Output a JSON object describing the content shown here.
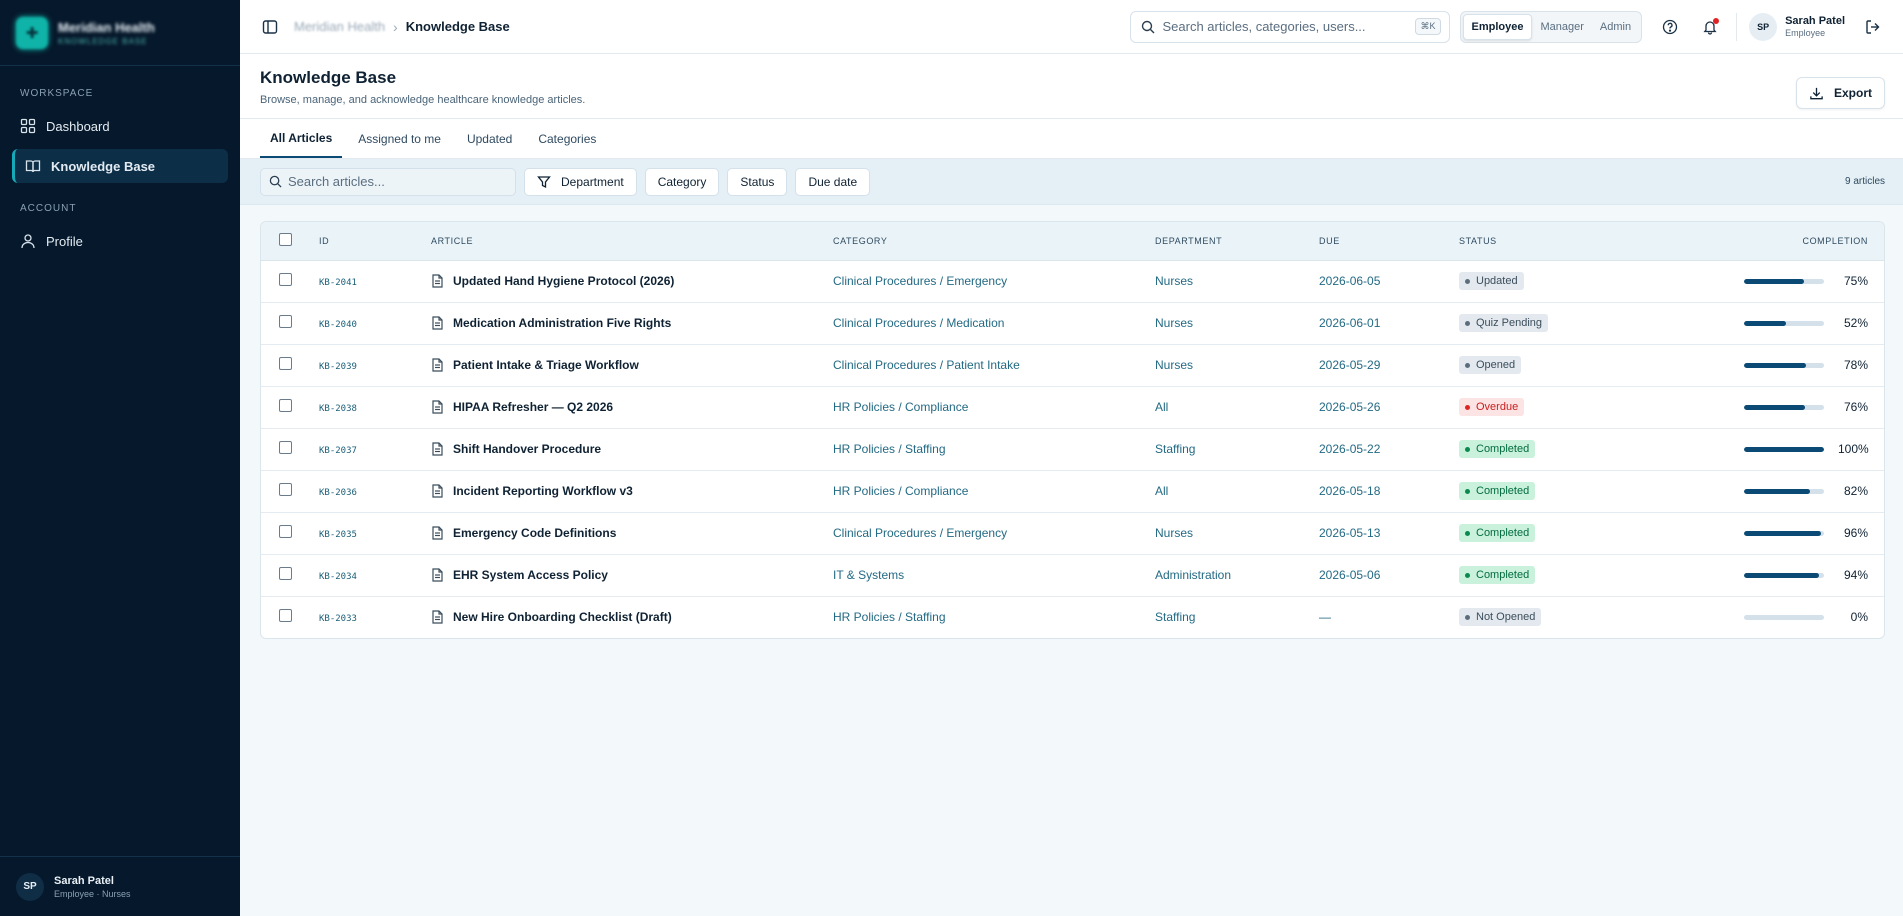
{
  "brand": {
    "name": "Meridian Health",
    "subtitle": "KNOWLEDGE BASE"
  },
  "sidebar": {
    "workspace_title": "WORKSPACE",
    "workspace_items": [
      {
        "label": "Dashboard",
        "icon": "dashboard-icon"
      },
      {
        "label": "Knowledge Base",
        "icon": "book-icon",
        "active": true
      }
    ],
    "account_title": "ACCOUNT",
    "account_items": [
      {
        "label": "Profile",
        "icon": "user-icon"
      }
    ],
    "user": {
      "initials": "SP",
      "name": "Sarah Patel",
      "role": "Employee · Nurses"
    }
  },
  "topbar": {
    "breadcrumb_root": "Meridian Health",
    "breadcrumb_current": "Knowledge Base",
    "search_placeholder": "Search articles, categories, users...",
    "search_shortcut": "⌘K",
    "roles": [
      "Employee",
      "Manager",
      "Admin"
    ],
    "active_role": "Employee",
    "user": {
      "initials": "SP",
      "name": "Sarah Patel",
      "role": "Employee"
    }
  },
  "page": {
    "title": "Knowledge Base",
    "subtitle": "Browse, manage, and acknowledge healthcare knowledge articles.",
    "export_label": "Export"
  },
  "tabs": [
    "All Articles",
    "Assigned to me",
    "Updated",
    "Categories"
  ],
  "filters": {
    "search_placeholder": "Search articles...",
    "chips": [
      "Department",
      "Category",
      "Status",
      "Due date"
    ],
    "count": "9 articles"
  },
  "table": {
    "headers": {
      "id": "ID",
      "article": "ARTICLE",
      "category": "CATEGORY",
      "department": "DEPARTMENT",
      "due": "DUE",
      "status": "STATUS",
      "completion": "COMPLETION"
    },
    "rows": [
      {
        "id": "KB-2041",
        "title": "Updated Hand Hygiene Protocol (2026)",
        "category": "Clinical Procedures / Emergency",
        "department": "Nurses",
        "due": "2026-06-05",
        "status": "Updated",
        "completion": 75
      },
      {
        "id": "KB-2040",
        "title": "Medication Administration Five Rights",
        "category": "Clinical Procedures / Medication",
        "department": "Nurses",
        "due": "2026-06-01",
        "status": "Quiz Pending",
        "completion": 52
      },
      {
        "id": "KB-2039",
        "title": "Patient Intake & Triage Workflow",
        "category": "Clinical Procedures / Patient Intake",
        "department": "Nurses",
        "due": "2026-05-29",
        "status": "Opened",
        "completion": 78
      },
      {
        "id": "KB-2038",
        "title": "HIPAA Refresher — Q2 2026",
        "category": "HR Policies / Compliance",
        "department": "All",
        "due": "2026-05-26",
        "status": "Overdue",
        "completion": 76
      },
      {
        "id": "KB-2037",
        "title": "Shift Handover Procedure",
        "category": "HR Policies / Staffing",
        "department": "Staffing",
        "due": "2026-05-22",
        "status": "Completed",
        "completion": 100
      },
      {
        "id": "KB-2036",
        "title": "Incident Reporting Workflow v3",
        "category": "HR Policies / Compliance",
        "department": "All",
        "due": "2026-05-18",
        "status": "Completed",
        "completion": 82
      },
      {
        "id": "KB-2035",
        "title": "Emergency Code Definitions",
        "category": "Clinical Procedures / Emergency",
        "department": "Nurses",
        "due": "2026-05-13",
        "status": "Completed",
        "completion": 96
      },
      {
        "id": "KB-2034",
        "title": "EHR System Access Policy",
        "category": "IT & Systems",
        "department": "Administration",
        "due": "2026-05-06",
        "status": "Completed",
        "completion": 94
      },
      {
        "id": "KB-2033",
        "title": "New Hire Onboarding Checklist (Draft)",
        "category": "HR Policies / Staffing",
        "department": "Staffing",
        "due": "—",
        "status": "Not Opened",
        "completion": 0
      }
    ]
  },
  "status_colors": {
    "Updated": {
      "bg": "#e3e9ee",
      "fg": "#3b4d5c",
      "dot": "#5c6e7d"
    },
    "Quiz Pending": {
      "bg": "#e3e9ee",
      "fg": "#3b4d5c",
      "dot": "#5c6e7d"
    },
    "Opened": {
      "bg": "#e3e9ee",
      "fg": "#3b4d5c",
      "dot": "#5c6e7d"
    },
    "Overdue": {
      "bg": "#fde4e4",
      "fg": "#c81e1e",
      "dot": "#e02424"
    },
    "Completed": {
      "bg": "#c9f1dc",
      "fg": "#046c3f",
      "dot": "#0a8a4f"
    },
    "Not Opened": {
      "bg": "#e3e9ee",
      "fg": "#3b4d5c",
      "dot": "#5c6e7d"
    }
  },
  "colors": {
    "sidebar_bg": "#06182b",
    "accent": "#0b4a75",
    "brand": "#0fb3a8"
  }
}
